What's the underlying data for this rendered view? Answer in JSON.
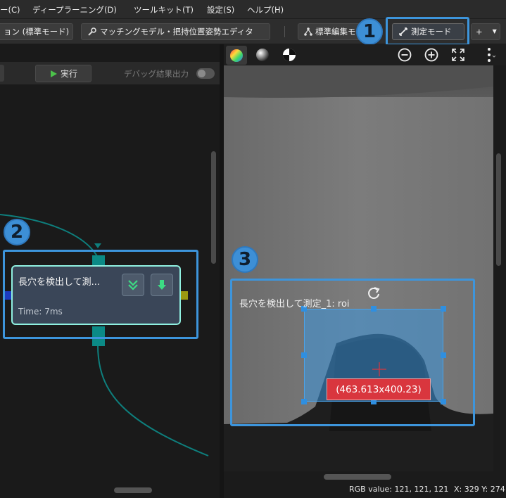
{
  "menu": {
    "items": [
      "ー(C)",
      "ディープラーニング(D)",
      "ツールキット(T)",
      "設定(S)",
      "ヘルプ(H)"
    ]
  },
  "toolbar": {
    "mode_label": "ョン (標準モード)",
    "matching_label": "マッチングモデル・把持位置姿勢エディタ",
    "standard_edit_label": "標準編集モ",
    "measure_mode_label": "測定モード",
    "plus_label": "+"
  },
  "left": {
    "run_label": "実行",
    "debug_label": "デバッグ結果出力",
    "node_title": "長穴を検出して測...",
    "node_time": "Time:  7ms"
  },
  "right": {
    "roi_label": "長穴を検出して測定_1: roi",
    "dimension_label": "(463.613x400.23)",
    "status_rgb": "RGB value: 121, 121, 121",
    "status_xy": "X: 329 Y: 274"
  },
  "callouts": [
    "1",
    "2",
    "3"
  ],
  "colors": {
    "accent": "#3d95dc",
    "node_border": "#8ff0e0",
    "port": "#0b8a86",
    "dimension_badge": "#d9363e"
  }
}
